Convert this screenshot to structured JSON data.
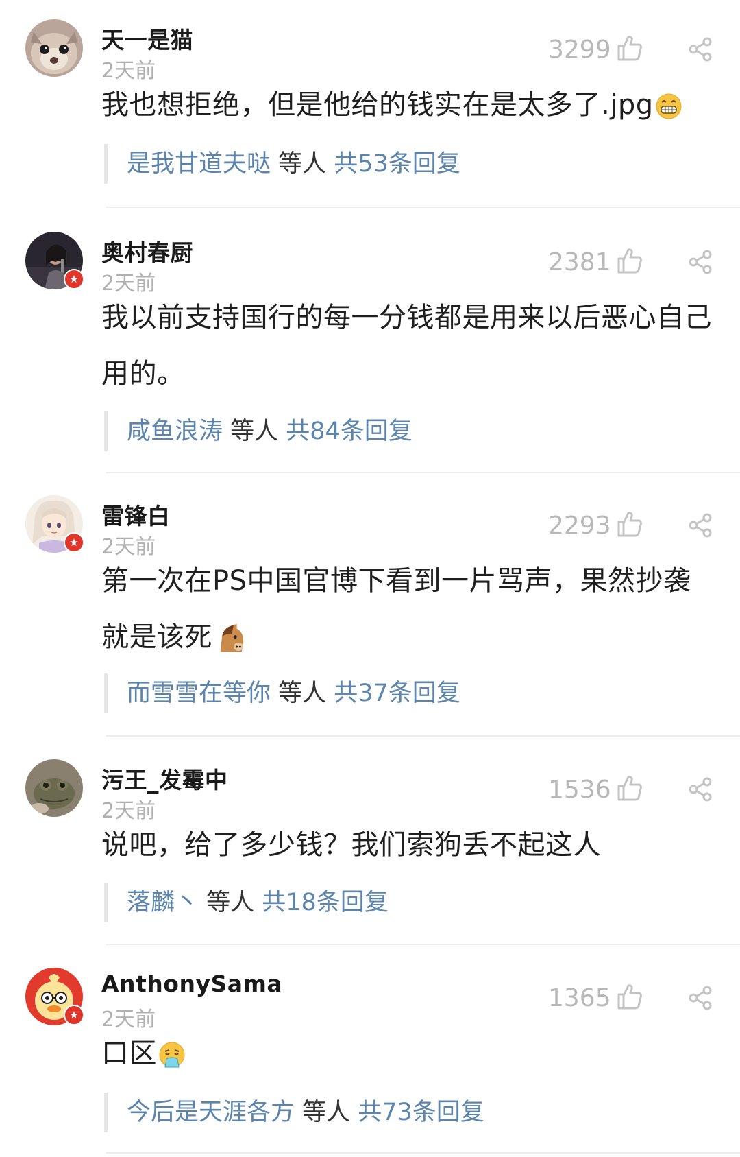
{
  "comments": [
    {
      "username": "天一是猫",
      "time": "2天前",
      "likes": "3299",
      "text": "我也想拒绝，但是他给的钱实在是太多了.jpg",
      "emoji": "grin-emoji",
      "reply_user": "是我甘道夫哒",
      "reply_mid": " 等人 ",
      "reply_count": "共53条回复",
      "verified": false,
      "avatar": "cat-avatar"
    },
    {
      "username": "奥村春厨",
      "time": "2天前",
      "likes": "2381",
      "text": "我以前支持国行的每一分钱都是用来以后恶心自己用的。",
      "emoji": "",
      "reply_user": "咸鱼浪涛",
      "reply_mid": " 等人 ",
      "reply_count": "共84条回复",
      "verified": true,
      "avatar": "singer-avatar"
    },
    {
      "username": "雷锋白",
      "time": "2天前",
      "likes": "2293",
      "text": "第一次在PS中国官博下看到一片骂声，果然抄袭就是该死",
      "emoji": "horse-emoji",
      "reply_user": "而雪雪在等你",
      "reply_mid": " 等人 ",
      "reply_count": "共37条回复",
      "verified": true,
      "avatar": "anime-girl-avatar"
    },
    {
      "username": "污王_发霉中",
      "time": "2天前",
      "likes": "1536",
      "text": "说吧，给了多少钱？我们索狗丢不起这人",
      "emoji": "",
      "reply_user": "落麟丶",
      "reply_mid": " 等人 ",
      "reply_count": "共18条回复",
      "verified": false,
      "avatar": "frog-avatar"
    },
    {
      "username": "AnthonySama",
      "time": "2天前",
      "likes": "1365",
      "text": "口区",
      "emoji": "vomit-emoji",
      "reply_user": "今后是天涯各方",
      "reply_mid": " 等人 ",
      "reply_count": "共73条回复",
      "verified": true,
      "avatar": "duck-avatar"
    }
  ],
  "colors": {
    "reply_link": "#5b85ad",
    "muted": "#b0b0b0",
    "badge": "#e0352b"
  }
}
